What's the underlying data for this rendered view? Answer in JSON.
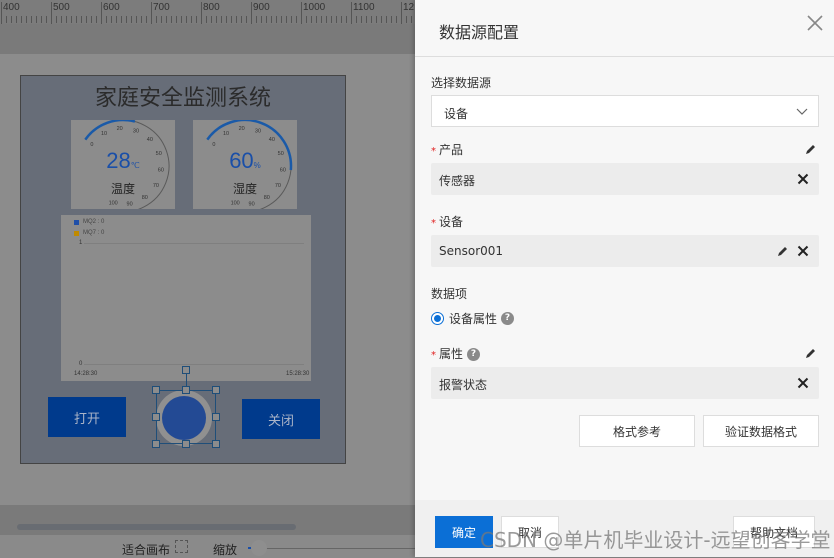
{
  "ruler": {
    "ticks": [
      "400",
      "500",
      "600",
      "700",
      "800",
      "900",
      "1000",
      "1100",
      "12"
    ]
  },
  "canvas": {
    "title": "家庭安全监测系统",
    "gauges": [
      {
        "value": "28",
        "unit": "℃",
        "label": "温度",
        "fraction": 0.28,
        "scale": [
          "0",
          "10",
          "20",
          "30",
          "40",
          "50",
          "60",
          "70",
          "80",
          "90",
          "100"
        ]
      },
      {
        "value": "60",
        "unit": "%",
        "label": "湿度",
        "fraction": 0.6,
        "scale": [
          "0",
          "10",
          "20",
          "30",
          "40",
          "50",
          "60",
          "70",
          "80",
          "90",
          "100"
        ]
      }
    ],
    "chart_data": {
      "type": "line",
      "series": [
        {
          "name": "MQ2",
          "legend": "MQ2 : 0",
          "color": "#1f4fa8",
          "values": []
        },
        {
          "name": "MQ7",
          "legend": "MQ7 : 0",
          "color": "#c08a00",
          "values": []
        }
      ],
      "y_ticks": [
        "1",
        "0"
      ],
      "ylim": [
        0,
        1
      ],
      "x_ticks": [
        "14:28:30",
        "15:28:30"
      ],
      "legend_position": "top-left"
    },
    "buttons": {
      "open": "打开",
      "close": "关闭"
    },
    "lamp": {
      "color": "#234a94"
    }
  },
  "bottom_bar": {
    "fit_label": "适合画布",
    "zoom_label": "缩放"
  },
  "panel": {
    "title": "数据源配置",
    "source_label": "选择数据源",
    "source_value": "设备",
    "product_label": "产品",
    "product_value": "传感器",
    "device_label": "设备",
    "device_value": "Sensor001",
    "data_item_label": "数据项",
    "data_item_option": "设备属性",
    "property_label": "属性",
    "property_value": "报警状态",
    "format_ref_button": "格式参考",
    "validate_button": "验证数据格式",
    "confirm_button": "确定",
    "cancel_button": "取消",
    "help_button": "帮助文档",
    "accent_color": "#0b6fd6"
  },
  "watermark": "CSDN @单片机毕业设计-远望创客学堂"
}
